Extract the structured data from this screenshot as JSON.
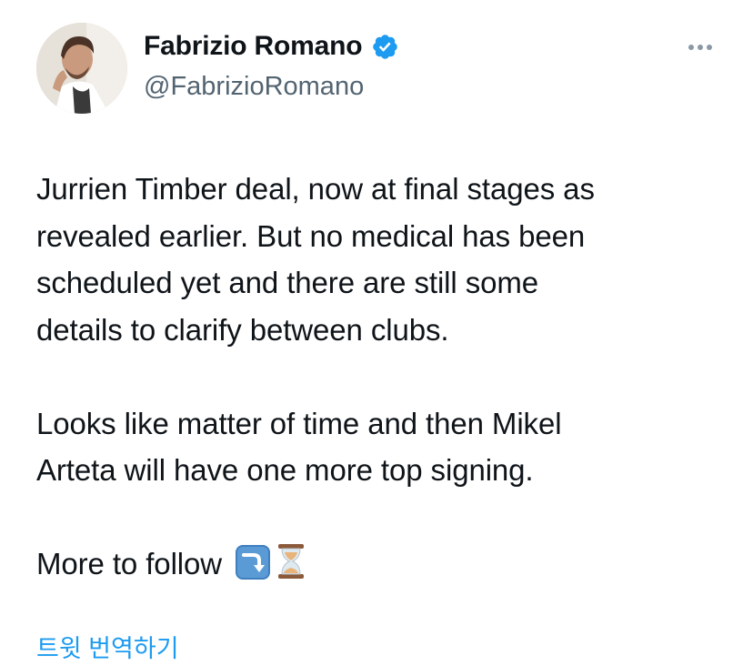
{
  "author": {
    "display_name": "Fabrizio Romano",
    "handle": "@FabrizioRomano",
    "verified": true,
    "avatar_icon": "profile-photo",
    "verified_icon": "verified-badge-icon"
  },
  "tweet": {
    "paragraphs": [
      {
        "lines": [
          "Jurrien Timber deal, now at final stages as",
          "revealed earlier. But no medical has been",
          "scheduled yet and there are still some",
          "details to clarify between clubs."
        ]
      },
      {
        "lines": [
          "Looks like matter of time and then Mikel",
          "Arteta will have one more top signing."
        ]
      }
    ],
    "last_line": {
      "text": "More to follow",
      "emojis": [
        "right-arrow-curving-down-emoji",
        "hourglass-emoji"
      ]
    }
  },
  "actions": {
    "more_icon": "more-horizontal-icon",
    "translate_label": "트윗 번역하기"
  },
  "colors": {
    "text": "#0f1419",
    "secondary": "#536471",
    "link": "#1d9bf0",
    "verified": "#1d9bf0"
  }
}
